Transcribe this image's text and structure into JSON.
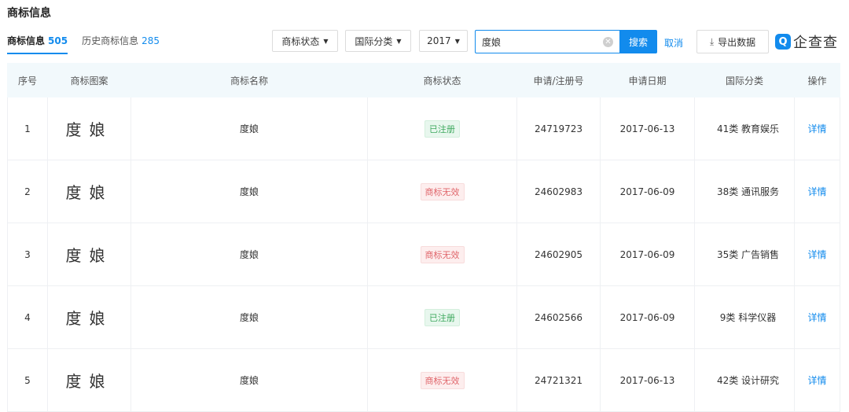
{
  "page": {
    "title": "商标信息"
  },
  "tabs": [
    {
      "label": "商标信息",
      "count": "505"
    },
    {
      "label": "历史商标信息",
      "count": "285"
    }
  ],
  "filters": {
    "status_label": "商标状态",
    "class_label": "国际分类",
    "year_value": "2017"
  },
  "search": {
    "value": "度娘",
    "button_label": "搜索",
    "cancel_label": "取消"
  },
  "export_label": "导出数据",
  "logo": {
    "text": "企查查"
  },
  "table": {
    "headers": [
      "序号",
      "商标图案",
      "商标名称",
      "商标状态",
      "申请/注册号",
      "申请日期",
      "国际分类",
      "操作"
    ],
    "rows": [
      {
        "index": "1",
        "image": "度娘",
        "name": "度娘",
        "status": "已注册",
        "status_type": "ok",
        "reg_no": "24719723",
        "date": "2017-06-13",
        "class": "41类 教育娱乐",
        "action": "详情"
      },
      {
        "index": "2",
        "image": "度娘",
        "name": "度娘",
        "status": "商标无效",
        "status_type": "bad",
        "reg_no": "24602983",
        "date": "2017-06-09",
        "class": "38类 通讯服务",
        "action": "详情"
      },
      {
        "index": "3",
        "image": "度娘",
        "name": "度娘",
        "status": "商标无效",
        "status_type": "bad",
        "reg_no": "24602905",
        "date": "2017-06-09",
        "class": "35类 广告销售",
        "action": "详情"
      },
      {
        "index": "4",
        "image": "度娘",
        "name": "度娘",
        "status": "已注册",
        "status_type": "ok",
        "reg_no": "24602566",
        "date": "2017-06-09",
        "class": "9类 科学仪器",
        "action": "详情"
      },
      {
        "index": "5",
        "image": "度娘",
        "name": "度娘",
        "status": "商标无效",
        "status_type": "bad",
        "reg_no": "24721321",
        "date": "2017-06-13",
        "class": "42类 设计研究",
        "action": "详情"
      }
    ]
  },
  "colors": {
    "accent": "#128bed",
    "name_red": "#d9333f",
    "ok_green": "#3fa95f",
    "bad_red": "#e0666b"
  }
}
